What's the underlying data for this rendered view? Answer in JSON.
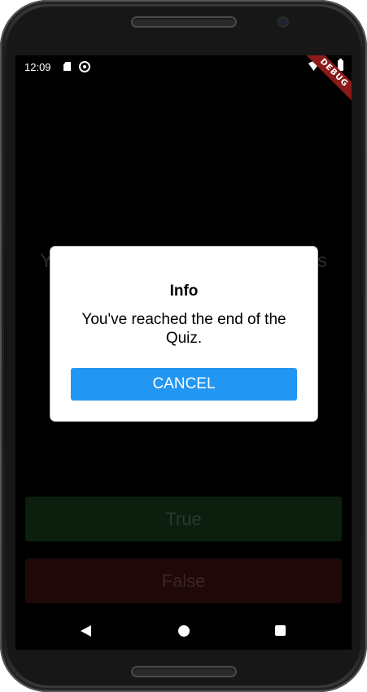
{
  "status_bar": {
    "time": "12:09",
    "icons": [
      "sd-card-icon",
      "sync-icon",
      "wifi-icon",
      "signal-icon",
      "battery-icon"
    ]
  },
  "debug_banner": "DEBUG",
  "quiz": {
    "question_partial_left": "Y",
    "question_partial_right": "s",
    "true_label": "True",
    "false_label": "False",
    "true_color": "#0c1e0e",
    "false_color": "#1f0808"
  },
  "dialog": {
    "title": "Info",
    "message": "You've reached the end of the Quiz.",
    "cancel_label": "CANCEL",
    "button_color": "#2196f3"
  },
  "nav_bar": {
    "icons": [
      "back-icon",
      "home-icon",
      "recents-icon"
    ]
  }
}
